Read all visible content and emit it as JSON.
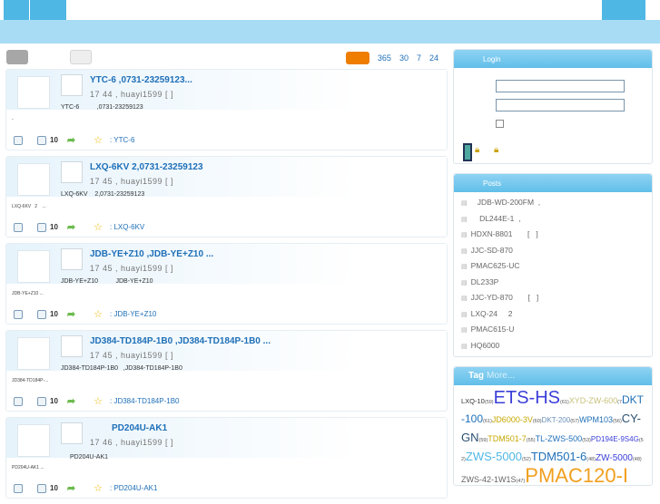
{
  "filter": {
    "sort_options": [
      "365",
      "30",
      "7",
      "24"
    ]
  },
  "posts": [
    {
      "title": "YTC-6          ,0731-23259123...",
      "meta": "17  44  ,  huayi1599   [      ]",
      "excerpt": "YTC-6          ,0731-23259123",
      "thumb_caption": "-",
      "count": "10",
      "tag_text": ": YTC-6"
    },
    {
      "title": "LXQ-6KV       2,0731-23259123",
      "meta": "17  45  ,  huayi1599   [      ]",
      "excerpt": "LXQ-6KV    2,0731-23259123",
      "thumb_caption": "LXQ-6KV   2    ...",
      "count": "10",
      "tag_text": ": LXQ-6KV"
    },
    {
      "title": "JDB-YE+Z10          ,JDB-YE+Z10        ...",
      "meta": "17  45  ,  huayi1599   [      ]",
      "excerpt": "JDB-YE+Z10          JDB-YE+Z10",
      "thumb_caption": "JDB-YE+Z10 ...",
      "count": "10",
      "tag_text": ": JDB-YE+Z10"
    },
    {
      "title": "JD384-TD184P-1B0     ,JD384-TD184P-1B0       ...",
      "meta": "17  45  ,  huayi1599   [      ]",
      "excerpt": "JD384-TD184P-1B0   ,JD384-TD184P-1B0",
      "thumb_caption": "JD384-TD184P-...",
      "count": "10",
      "tag_text": ": JD384-TD184P-1B0"
    },
    {
      "title": "PD204U-AK1",
      "meta": "17  46  ,  huayi1599   [      ]",
      "excerpt": "PD204U-AK1",
      "thumb_caption": "PD204U-AK1 ...",
      "count": "10",
      "tag_text": ": PD204U-AK1"
    }
  ],
  "login": {
    "title": "Login"
  },
  "posts_box": {
    "title": "Posts",
    "items": [
      "   JDB-WD-200FM  ,",
      "    DL244E-1  ,",
      "HDXN-8801       [   ]",
      "JJC-SD-870",
      "PMAC625-UC",
      "DL233P",
      "JJC-YD-870       [   ]",
      "LXQ-24     2",
      "PMAC615-U",
      "HQ6000"
    ]
  },
  "tags_box": {
    "title": "Tag",
    "more": "More...",
    "tags": [
      {
        "name": "LXQ-10",
        "count": "(59)",
        "size": "7.5px",
        "color": "#333333"
      },
      {
        "name": "ETS-HS",
        "count": "(61)",
        "size": "20px",
        "color": "#3b3fd8"
      },
      {
        "name": "XYD-ZW-600",
        "count": "(7",
        "size": "9px",
        "color": "#c6c27a"
      },
      {
        "name": "DKT-100",
        "count": "(61)",
        "size": "12px",
        "color": "#1e6fb8"
      },
      {
        "name": "JD6000-3V",
        "count": "(60)",
        "size": "9px",
        "color": "#c6a800"
      },
      {
        "name": "DKT-200",
        "count": "(57)",
        "size": "8px",
        "color": "#6a8fbb"
      },
      {
        "name": "WPM103",
        "count": "(56)",
        "size": "9px",
        "color": "#1e6fb8"
      },
      {
        "name": "CY-GN",
        "count": "(59)",
        "size": "13px",
        "color": "#2a4f70"
      },
      {
        "name": "TDM501-7",
        "count": "(55)",
        "size": "9px",
        "color": "#c6a800"
      },
      {
        "name": "TL-ZWS-500",
        "count": "(53)",
        "size": "9px",
        "color": "#1e6fb8"
      },
      {
        "name": "PD194E-9S4G",
        "count": "(52)",
        "size": "8px",
        "color": "#3b3fd8"
      },
      {
        "name": "ZWS-5000",
        "count": "(52)",
        "size": "13px",
        "color": "#4fb7e4"
      },
      {
        "name": "TDM501-6",
        "count": "(48)",
        "size": "13px",
        "color": "#1e6fb8"
      },
      {
        "name": "ZW-5000",
        "count": "(48)",
        "size": "10px",
        "color": "#3b3fd8"
      },
      {
        "name": "ZWS-42-1W1S",
        "count": "(47)",
        "size": "9px",
        "color": "#666666"
      },
      {
        "name": "PM",
        "count": "",
        "size": "22px",
        "color": "#f0a020"
      },
      {
        "name": "AC120-I",
        "count": "",
        "size": "22px",
        "color": "#f0a020"
      }
    ]
  }
}
